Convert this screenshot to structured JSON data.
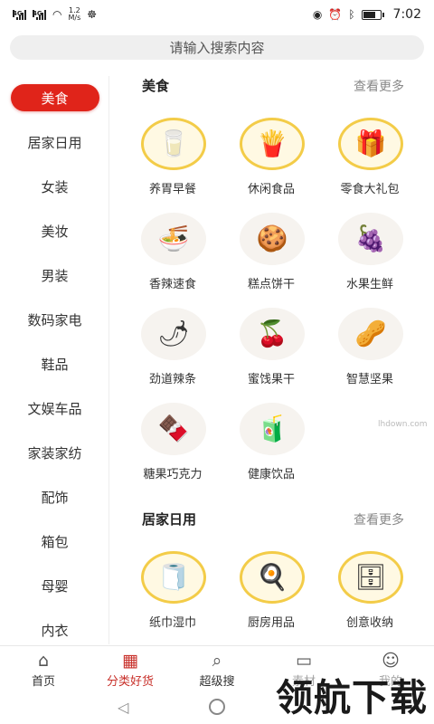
{
  "status_bar": {
    "network_1": "4G",
    "network_2": "4G",
    "speed_value": "1.2",
    "speed_unit": "M/s",
    "time": "7:02",
    "battery_percent": 75
  },
  "search": {
    "placeholder": "请输入搜索内容"
  },
  "sidebar": {
    "active_index": 0,
    "items": [
      {
        "label": "美食"
      },
      {
        "label": "居家日用"
      },
      {
        "label": "女装"
      },
      {
        "label": "美妆"
      },
      {
        "label": "男装"
      },
      {
        "label": "数码家电"
      },
      {
        "label": "鞋品"
      },
      {
        "label": "文娱车品"
      },
      {
        "label": "家装家纺"
      },
      {
        "label": "配饰"
      },
      {
        "label": "箱包"
      },
      {
        "label": "母婴"
      },
      {
        "label": "内衣"
      }
    ]
  },
  "sections": [
    {
      "title": "美食",
      "more": "查看更多",
      "items": [
        {
          "label": "养胃早餐",
          "icon": "🥛"
        },
        {
          "label": "休闲食品",
          "icon": "🍟"
        },
        {
          "label": "零食大礼包",
          "icon": "🎁"
        },
        {
          "label": "香辣速食",
          "icon": "🍜"
        },
        {
          "label": "糕点饼干",
          "icon": "🍪"
        },
        {
          "label": "水果生鲜",
          "icon": "🍇"
        },
        {
          "label": "劲道辣条",
          "icon": "🌶"
        },
        {
          "label": "蜜饯果干",
          "icon": "🍒"
        },
        {
          "label": "智慧坚果",
          "icon": "🥜"
        },
        {
          "label": "糖果巧克力",
          "icon": "🍫"
        },
        {
          "label": "健康饮品",
          "icon": "🧃"
        }
      ]
    },
    {
      "title": "居家日用",
      "more": "查看更多",
      "items": [
        {
          "label": "纸巾湿巾",
          "icon": "🧻"
        },
        {
          "label": "厨房用品",
          "icon": "🍳"
        },
        {
          "label": "创意收纳",
          "icon": "🗄"
        }
      ]
    }
  ],
  "bottom_nav": {
    "active_index": 1,
    "items": [
      {
        "label": "首页",
        "icon": "home-icon"
      },
      {
        "label": "分类好货",
        "icon": "category-icon"
      },
      {
        "label": "超级搜",
        "icon": "search-icon"
      },
      {
        "label": "素材",
        "icon": "folder-icon"
      },
      {
        "label": "我的",
        "icon": "user-icon"
      }
    ]
  },
  "watermark": {
    "text": "领航下载",
    "site": "lhdown.com"
  }
}
